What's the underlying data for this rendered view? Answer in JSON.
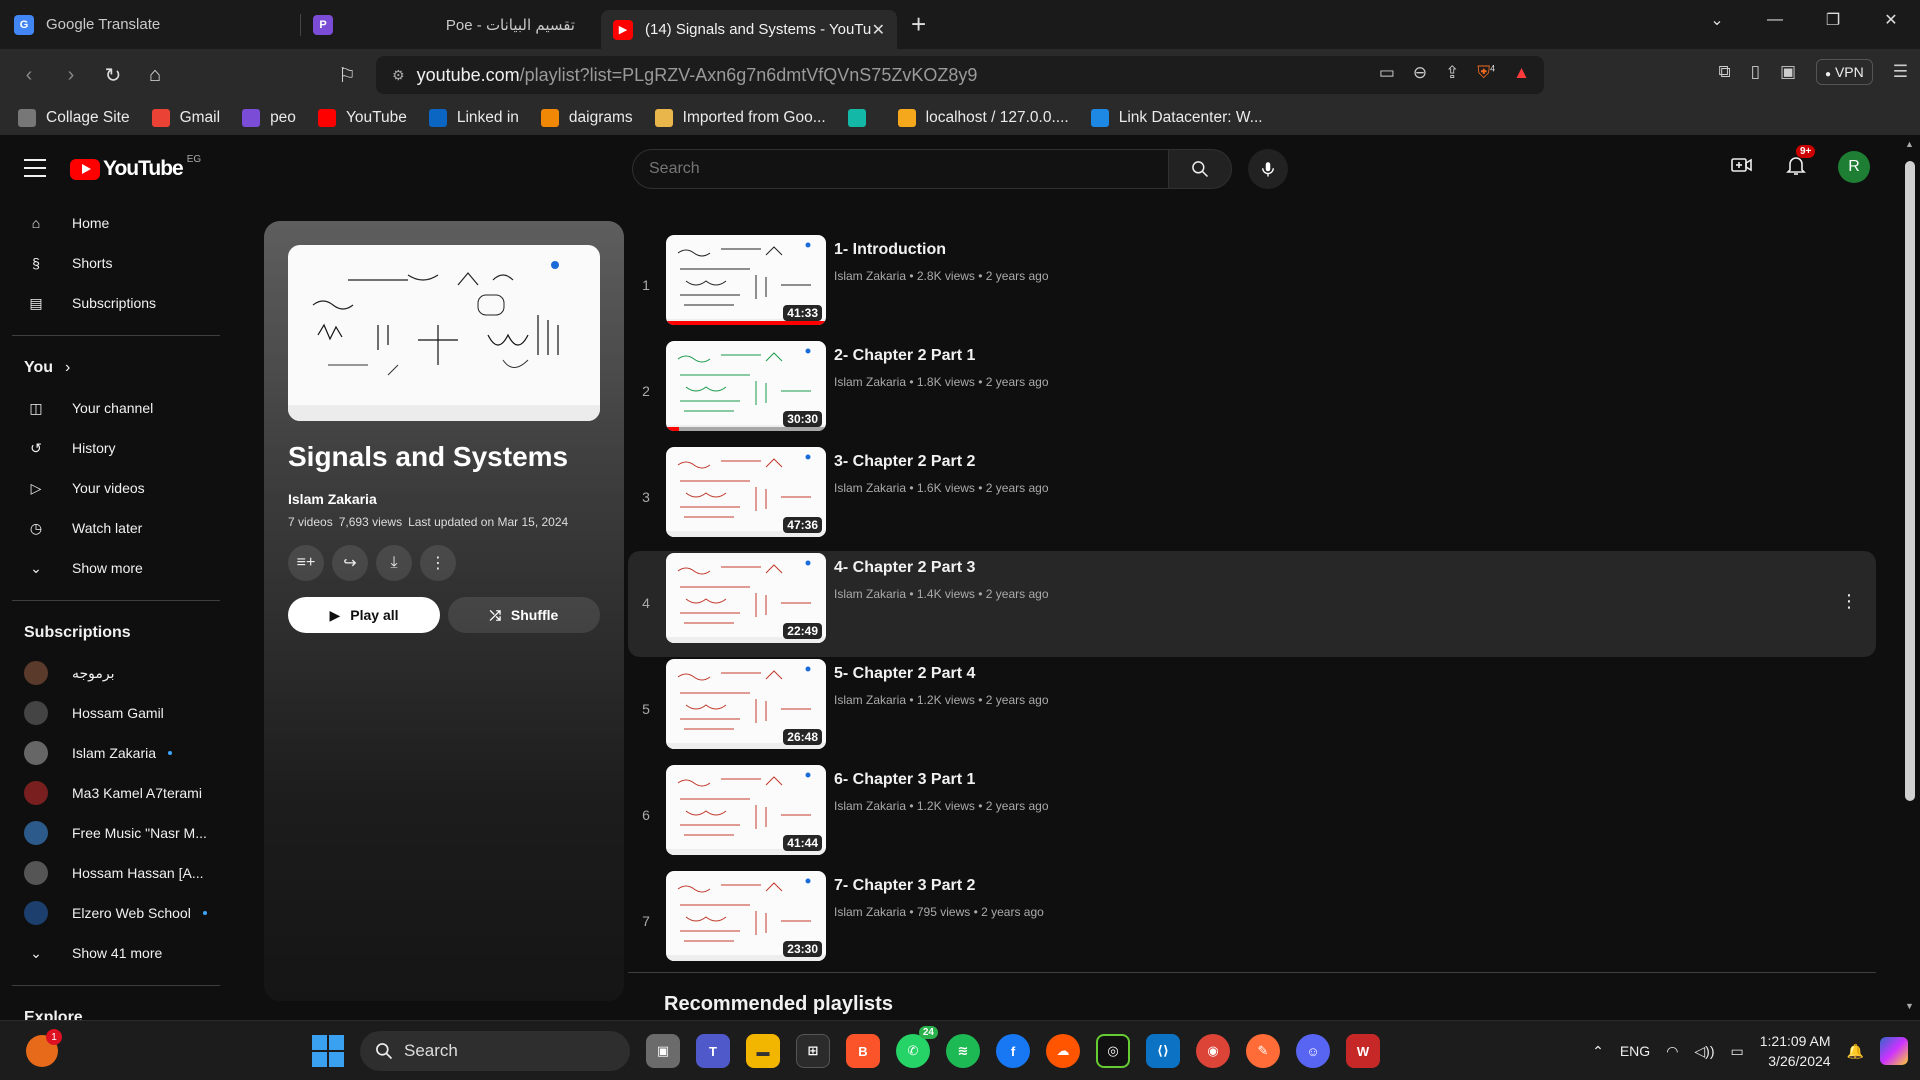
{
  "browser": {
    "tabs": [
      {
        "label": "Google Translate"
      },
      {
        "label": "Poe - تقسيم البيانات"
      },
      {
        "label": "(14) Signals and Systems - YouTu"
      }
    ],
    "url_host": "youtube.com",
    "url_path": "/playlist?list=PLgRZV-Axn6g7n6dmtVfQVnS75ZvKOZ8y9",
    "vpn_label": "VPN",
    "shield_count": "4",
    "bookmarks": [
      {
        "label": "Collage Site",
        "color": "#777777"
      },
      {
        "label": "Gmail",
        "color": "#ea4335"
      },
      {
        "label": "peo",
        "color": "#7b4dd6"
      },
      {
        "label": "YouTube",
        "color": "#ff0000"
      },
      {
        "label": "Linked in",
        "color": "#0a66c2"
      },
      {
        "label": "daigrams",
        "color": "#f08705"
      },
      {
        "label": "Imported from Goo...",
        "color": "#e8b64a"
      },
      {
        "label": "",
        "color": "#14b8a6"
      },
      {
        "label": "localhost / 127.0.0....",
        "color": "#f6a81c"
      },
      {
        "label": "Link Datacenter: W...",
        "color": "#1e88e5"
      }
    ]
  },
  "youtube": {
    "country_code": "EG",
    "logo_text": "YouTube",
    "search_placeholder": "Search",
    "notification_count": "9+",
    "avatar_letter": "R",
    "sidebar": {
      "main": [
        {
          "label": "Home",
          "icon": "home-icon"
        },
        {
          "label": "Shorts",
          "icon": "shorts-icon"
        },
        {
          "label": "Subscriptions",
          "icon": "subscriptions-icon"
        }
      ],
      "you_heading": "You",
      "you_items": [
        {
          "label": "Your channel",
          "icon": "channel-icon"
        },
        {
          "label": "History",
          "icon": "history-icon"
        },
        {
          "label": "Your videos",
          "icon": "your-videos-icon"
        },
        {
          "label": "Watch later",
          "icon": "watch-later-icon"
        },
        {
          "label": "Show more",
          "icon": "chevron-down-icon"
        }
      ],
      "subscriptions_heading": "Subscriptions",
      "subscriptions": [
        {
          "label": "برموجه",
          "color": "#5a3a2a",
          "dot": false
        },
        {
          "label": "Hossam Gamil",
          "color": "#444444",
          "dot": false
        },
        {
          "label": "Islam Zakaria",
          "color": "#666666",
          "dot": true
        },
        {
          "label": "Ma3 Kamel A7terami",
          "color": "#7a1f1f",
          "dot": false
        },
        {
          "label": "Free Music \"Nasr M...",
          "color": "#2c5a8a",
          "dot": false
        },
        {
          "label": "Hossam Hassan [A...",
          "color": "#555555",
          "dot": false
        },
        {
          "label": "Elzero Web School",
          "color": "#1c3f6e",
          "dot": true
        }
      ],
      "show_more_subs": "Show 41 more",
      "explore_heading": "Explore"
    },
    "playlist": {
      "title": "Signals and Systems",
      "owner": "Islam Zakaria",
      "video_count": "7 videos",
      "views": "7,693 views",
      "updated": "Last updated on Mar 15, 2024",
      "play_all": "Play all",
      "shuffle": "Shuffle"
    },
    "videos": [
      {
        "index": "1",
        "title": "1- Introduction",
        "meta": "Islam Zakaria • 2.8K views • 2 years ago",
        "duration": "41:33",
        "progress": 1.0
      },
      {
        "index": "2",
        "title": "2- Chapter 2 Part 1",
        "meta": "Islam Zakaria • 1.8K views • 2 years ago",
        "duration": "30:30",
        "progress": 0.08
      },
      {
        "index": "3",
        "title": "3- Chapter 2 Part 2",
        "meta": "Islam Zakaria • 1.6K views • 2 years ago",
        "duration": "47:36",
        "progress": 0
      },
      {
        "index": "4",
        "title": "4- Chapter 2 Part 3",
        "meta": "Islam Zakaria • 1.4K views • 2 years ago",
        "duration": "22:49",
        "progress": 0
      },
      {
        "index": "5",
        "title": "5- Chapter 2 Part 4",
        "meta": "Islam Zakaria • 1.2K views • 2 years ago",
        "duration": "26:48",
        "progress": 0
      },
      {
        "index": "6",
        "title": "6- Chapter 3 Part 1",
        "meta": "Islam Zakaria • 1.2K views • 2 years ago",
        "duration": "41:44",
        "progress": 0
      },
      {
        "index": "7",
        "title": "7- Chapter 3 Part 2",
        "meta": "Islam Zakaria • 795 views • 2 years ago",
        "duration": "23:30",
        "progress": 0
      }
    ],
    "recommended_heading": "Recommended playlists"
  },
  "taskbar": {
    "search_label": "Search",
    "whatsapp_badge": "24",
    "firefox_badge": "1",
    "language": "ENG",
    "time": "1:21:09 AM",
    "date": "3/26/2024"
  }
}
